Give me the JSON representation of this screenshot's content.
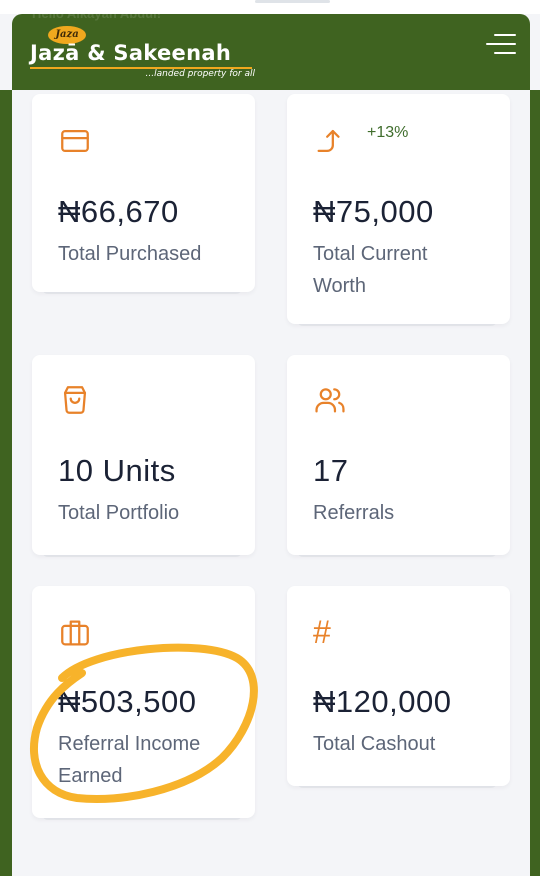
{
  "header": {
    "ghost_text": "Hello Alkayah Abdul!",
    "brand_badge": "Jaza",
    "brand_name": "Jazā & Sakeenah",
    "tagline": "...landed property for all"
  },
  "cards": {
    "total_purchased": {
      "icon": "credit-card-icon",
      "amount": "₦66,670",
      "label": "Total Purchased"
    },
    "total_current_worth": {
      "icon": "trend-up-arrow-icon",
      "change": "+13%",
      "amount": "₦75,000",
      "label": "Total Current Worth"
    },
    "total_portfolio": {
      "icon": "shopping-bag-icon",
      "amount": "10 Units",
      "label": "Total Portfolio"
    },
    "referrals": {
      "icon": "users-icon",
      "amount": "17",
      "label": "Referrals"
    },
    "referral_income": {
      "icon": "briefcase-icon",
      "amount": "₦503,500",
      "label": "Referral Income Earned"
    },
    "total_cashout": {
      "icon": "hash-icon",
      "symbol": "#",
      "amount": "₦120,000",
      "label": "Total Cashout"
    }
  },
  "colors": {
    "brand_green": "#3f6320",
    "accent_orange": "#e8822a",
    "positive_green": "#3f6d2c",
    "highlight_ring": "#f7b32b"
  }
}
